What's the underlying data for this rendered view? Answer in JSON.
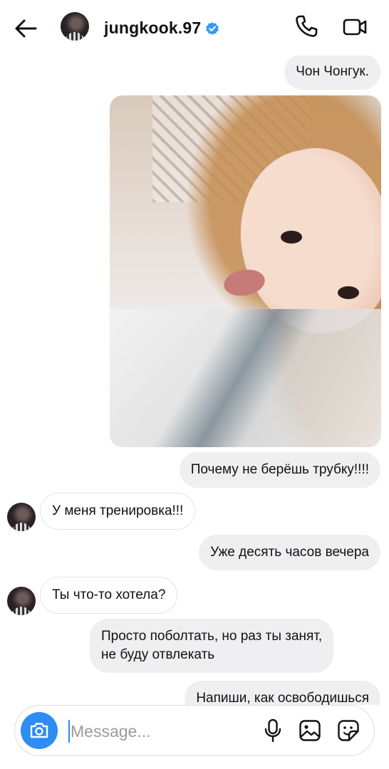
{
  "header": {
    "username": "jungkook.97",
    "verified": true,
    "back_icon": "arrow-left-icon",
    "call_icon": "phone-icon",
    "video_icon": "video-camera-icon"
  },
  "messages": [
    {
      "side": "out",
      "type": "text",
      "text": "Чон Чонгук."
    },
    {
      "side": "out",
      "type": "image",
      "icon": "photo"
    },
    {
      "side": "out",
      "type": "text",
      "text": "Почему не берёшь трубку!!!!"
    },
    {
      "side": "in",
      "type": "text",
      "text": "У меня тренировка!!!"
    },
    {
      "side": "out",
      "type": "text",
      "text": "Уже десять часов вечера"
    },
    {
      "side": "in",
      "type": "text",
      "text": "Ты что-то хотела?"
    },
    {
      "side": "out",
      "type": "text",
      "text": "Просто поболтать, но раз ты занят,\nне буду отвлекать"
    },
    {
      "side": "out",
      "type": "text",
      "text": "Напиши, как освободишься"
    }
  ],
  "composer": {
    "placeholder": "Message...",
    "camera_icon": "camera-icon",
    "mic_icon": "microphone-icon",
    "gallery_icon": "image-gallery-icon",
    "sticker_icon": "sticker-icon"
  },
  "colors": {
    "accent": "#2e8df0",
    "outgoing_bubble": "#efeff1",
    "verified_badge": "#3897f0"
  }
}
